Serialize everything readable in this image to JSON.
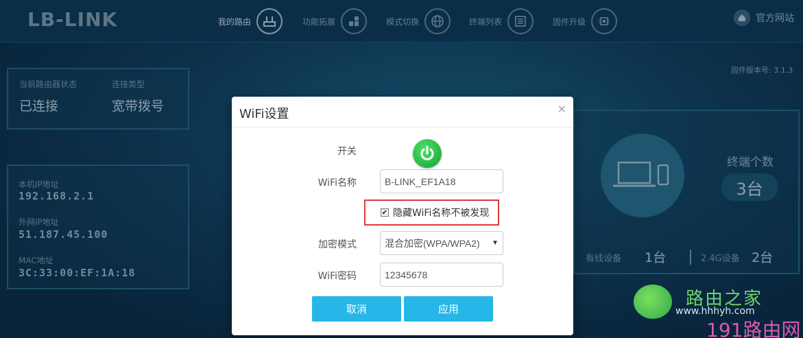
{
  "brand": {
    "logo": "LB-LINK"
  },
  "nav": [
    {
      "label": "我的路由",
      "icon": "router-icon"
    },
    {
      "label": "功能拓展",
      "icon": "blocks-icon"
    },
    {
      "label": "模式切换",
      "icon": "globe-icon"
    },
    {
      "label": "终端列表",
      "icon": "list-icon"
    },
    {
      "label": "固件升级",
      "icon": "chip-icon"
    }
  ],
  "home": {
    "label": "官方网站"
  },
  "firmware": "固件版本号: 3.1.3",
  "status": {
    "state_label": "当前路由器状态",
    "state_value": "已连接",
    "conn_label": "连接类型",
    "conn_value": "宽带拨号"
  },
  "network": {
    "lan_ip_label": "本机IP地址",
    "lan_ip": "192.168.2.1",
    "wan_ip_label": "外网IP地址",
    "wan_ip": "51.187.45.100",
    "mac_label": "MAC地址",
    "mac": "3C:33:00:EF:1A:18"
  },
  "devices": {
    "count_label": "终端个数",
    "count": "3台",
    "wired_label": "有线设备",
    "wired": "1台",
    "g24_label": "2.4G设备",
    "g24": "2台"
  },
  "dialog": {
    "title": "WiFi设置",
    "close": "×",
    "switch_label": "开关",
    "ssid_label": "WiFi名称",
    "ssid_value": "B-LINK_EF1A18",
    "hide_label": "隐藏WiFi名称不被发现",
    "hide_checked": true,
    "enc_label": "加密模式",
    "enc_value": "混合加密(WPA/WPA2)",
    "pwd_label": "WiFi密码",
    "pwd_value": "12345678",
    "cancel": "取消",
    "apply": "应用"
  },
  "watermark": {
    "line1": "路由之家",
    "line2": "www.hhhyh.com",
    "line3": "191路由网"
  }
}
